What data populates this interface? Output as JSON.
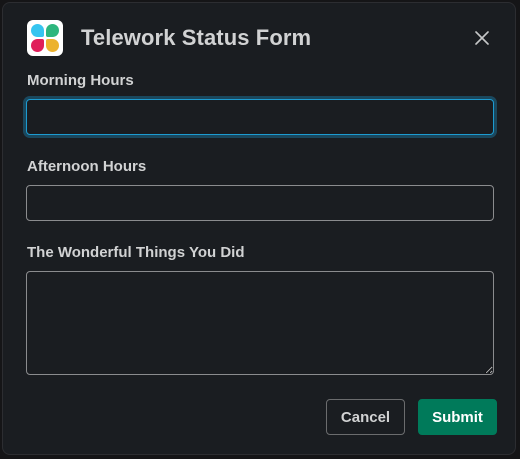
{
  "modal": {
    "title": "Telework Status Form",
    "app_icon": "slack-logo-icon",
    "close_icon": "close-icon"
  },
  "fields": {
    "morning": {
      "label": "Morning Hours",
      "value": ""
    },
    "afternoon": {
      "label": "Afternoon Hours",
      "value": ""
    },
    "things": {
      "label": "The Wonderful Things You Did",
      "value": ""
    }
  },
  "actions": {
    "cancel_label": "Cancel",
    "submit_label": "Submit"
  },
  "colors": {
    "background": "#1a1d21",
    "text": "#d1d2d3",
    "focus": "#1d9bd1",
    "submit": "#007a5a",
    "logo_blue": "#36c5f0",
    "logo_green": "#2eb67d",
    "logo_red": "#e01e5a",
    "logo_yellow": "#ecb22e"
  }
}
